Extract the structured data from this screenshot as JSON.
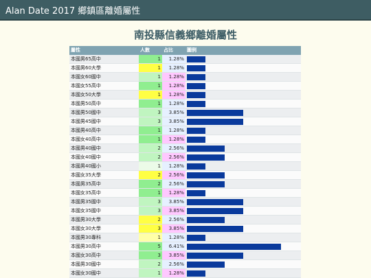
{
  "app": {
    "title": "Alan Date 2017 鄉鎮區離婚屬性"
  },
  "page": {
    "heading": "南投縣信義鄉離婚屬性"
  },
  "table": {
    "headers": {
      "attr": "屬性",
      "count": "人數",
      "pct": "占比",
      "legend": "圖例"
    },
    "rows": [
      {
        "attr": "本國男65高中",
        "count": "1",
        "pct": "1.28%",
        "count_color": "#90ee90",
        "pct_color": "#e6f0ff",
        "value": 1.28
      },
      {
        "attr": "本國男60大學",
        "count": "1",
        "pct": "1.28%",
        "count_color": "#ffff44",
        "pct_color": "#e6f0ff",
        "value": 1.28
      },
      {
        "attr": "本國女60國中",
        "count": "1",
        "pct": "1.28%",
        "count_color": "#c0f5c0",
        "pct_color": "#ffc8ff",
        "value": 1.28
      },
      {
        "attr": "本國女55高中",
        "count": "1",
        "pct": "1.28%",
        "count_color": "#90ee90",
        "pct_color": "#ffc8ff",
        "value": 1.28
      },
      {
        "attr": "本國女50大學",
        "count": "1",
        "pct": "1.28%",
        "count_color": "#ffff44",
        "pct_color": "#ffc8ff",
        "value": 1.28
      },
      {
        "attr": "本國男50高中",
        "count": "1",
        "pct": "1.28%",
        "count_color": "#90ee90",
        "pct_color": "#e6f0ff",
        "value": 1.28
      },
      {
        "attr": "本國男50國中",
        "count": "3",
        "pct": "3.85%",
        "count_color": "#c0f5c0",
        "pct_color": "#e6f0ff",
        "value": 3.85
      },
      {
        "attr": "本國男45國中",
        "count": "3",
        "pct": "3.85%",
        "count_color": "#c0f5c0",
        "pct_color": "#e6f0ff",
        "value": 3.85
      },
      {
        "attr": "本國男40高中",
        "count": "1",
        "pct": "1.28%",
        "count_color": "#90ee90",
        "pct_color": "#e6f0ff",
        "value": 1.28
      },
      {
        "attr": "本國女40高中",
        "count": "1",
        "pct": "1.28%",
        "count_color": "#90ee90",
        "pct_color": "#ffc8ff",
        "value": 1.28
      },
      {
        "attr": "本國男40國中",
        "count": "2",
        "pct": "2.56%",
        "count_color": "#c0f5c0",
        "pct_color": "#e6f0ff",
        "value": 2.56
      },
      {
        "attr": "本國女40國中",
        "count": "2",
        "pct": "2.56%",
        "count_color": "#c0f5c0",
        "pct_color": "#ffc8ff",
        "value": 2.56
      },
      {
        "attr": "本國男40國小",
        "count": "1",
        "pct": "1.28%",
        "count_color": "#ecfbe8",
        "pct_color": "#e6f0ff",
        "value": 1.28
      },
      {
        "attr": "本國女35大學",
        "count": "2",
        "pct": "2.56%",
        "count_color": "#ffff44",
        "pct_color": "#ffc8ff",
        "value": 2.56
      },
      {
        "attr": "本國男35高中",
        "count": "2",
        "pct": "2.56%",
        "count_color": "#90ee90",
        "pct_color": "#e6f0ff",
        "value": 2.56
      },
      {
        "attr": "本國女35高中",
        "count": "1",
        "pct": "1.28%",
        "count_color": "#90ee90",
        "pct_color": "#ffc8ff",
        "value": 1.28
      },
      {
        "attr": "本國男35國中",
        "count": "3",
        "pct": "3.85%",
        "count_color": "#c0f5c0",
        "pct_color": "#e6f0ff",
        "value": 3.85
      },
      {
        "attr": "本國女35國中",
        "count": "3",
        "pct": "3.85%",
        "count_color": "#c0f5c0",
        "pct_color": "#ffc8ff",
        "value": 3.85
      },
      {
        "attr": "本國男30大學",
        "count": "2",
        "pct": "2.56%",
        "count_color": "#ffff44",
        "pct_color": "#e6f0ff",
        "value": 2.56
      },
      {
        "attr": "本國女30大學",
        "count": "3",
        "pct": "3.85%",
        "count_color": "#ffff44",
        "pct_color": "#ffc8ff",
        "value": 3.85
      },
      {
        "attr": "本國男30專科",
        "count": "1",
        "pct": "1.28%",
        "count_color": "#ffffa8",
        "pct_color": "#e6f0ff",
        "value": 1.28
      },
      {
        "attr": "本國男30高中",
        "count": "5",
        "pct": "6.41%",
        "count_color": "#90ee90",
        "pct_color": "#e6f0ff",
        "value": 6.41
      },
      {
        "attr": "本國女30高中",
        "count": "3",
        "pct": "3.85%",
        "count_color": "#90ee90",
        "pct_color": "#ffc8ff",
        "value": 3.85
      },
      {
        "attr": "本國男30國中",
        "count": "2",
        "pct": "2.56%",
        "count_color": "#c0f5c0",
        "pct_color": "#e6f0ff",
        "value": 2.56
      },
      {
        "attr": "本國女30國中",
        "count": "1",
        "pct": "1.28%",
        "count_color": "#c0f5c0",
        "pct_color": "#ffc8ff",
        "value": 1.28
      }
    ]
  },
  "colors": {
    "bar": "#0a3a9c",
    "header_bg": "#7fa3b1",
    "topbar_bg": "#3e5d63"
  }
}
